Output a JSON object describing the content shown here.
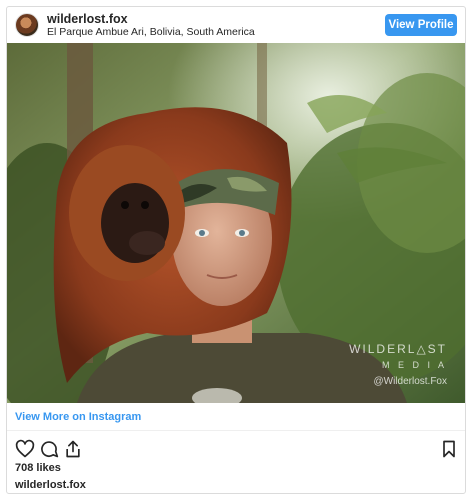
{
  "header": {
    "username": "wilderlost.fox",
    "location": "El Parque Ambue Ari, Bolivia, South America",
    "view_profile_label": "View Profile"
  },
  "photo": {
    "watermark_line1": "WILDERL△ST",
    "watermark_line2": "M E D I A",
    "watermark_line3": "@Wilderlost.Fox"
  },
  "view_more_label": "View More on Instagram",
  "actions": {
    "like_icon": "heart-icon",
    "comment_icon": "comment-icon",
    "share_icon": "share-icon",
    "save_icon": "bookmark-icon"
  },
  "likes_text": "708 likes",
  "footer_username": "wilderlost.fox",
  "colors": {
    "accent": "#3897f0",
    "text": "#262626",
    "border": "#dbdbdb"
  }
}
